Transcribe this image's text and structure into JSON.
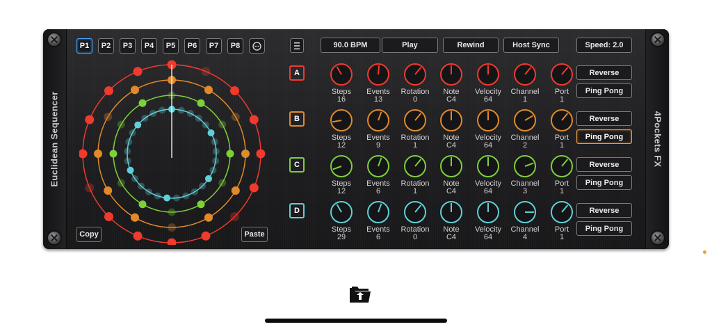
{
  "plugin": {
    "left_label": "Euclidean Sequencer",
    "right_label": "4Pockets FX"
  },
  "patterns": [
    "P1",
    "P2",
    "P3",
    "P4",
    "P5",
    "P6",
    "P7",
    "P8"
  ],
  "selected_pattern": "P1",
  "toolbar": {
    "menu_icon": "hamburger-icon",
    "more_icon": "more-dots-icon",
    "bpm": "90.0 BPM",
    "play": "Play",
    "rewind": "Rewind",
    "host_sync": "Host Sync",
    "speed": "Speed: 2.0"
  },
  "actions": {
    "copy": "Copy",
    "paste": "Paste"
  },
  "param_names": [
    "Steps",
    "Events",
    "Rotation",
    "Note",
    "Velocity",
    "Channel",
    "Port"
  ],
  "tracks": [
    {
      "id": "A",
      "color": "#f03a2e",
      "values": [
        "16",
        "13",
        "0",
        "C4",
        "64",
        "1",
        "1"
      ],
      "reverse": "Reverse",
      "ping_pong": "Ping Pong",
      "ping_pong_active": false
    },
    {
      "id": "B",
      "color": "#e08a2c",
      "values": [
        "12",
        "9",
        "1",
        "C4",
        "64",
        "2",
        "1"
      ],
      "reverse": "Reverse",
      "ping_pong": "Ping Pong",
      "ping_pong_active": true
    },
    {
      "id": "C",
      "color": "#7ed03a",
      "values": [
        "12",
        "6",
        "1",
        "C4",
        "64",
        "3",
        "1"
      ],
      "reverse": "Reverse",
      "ping_pong": "Ping Pong",
      "ping_pong_active": false
    },
    {
      "id": "D",
      "color": "#5fd0d8",
      "values": [
        "29",
        "6",
        "0",
        "C4",
        "64",
        "4",
        "1"
      ],
      "reverse": "Reverse",
      "ping_pong": "Ping Pong",
      "ping_pong_active": false
    }
  ],
  "bottom": {
    "tray_icon": "folder-open-icon"
  }
}
